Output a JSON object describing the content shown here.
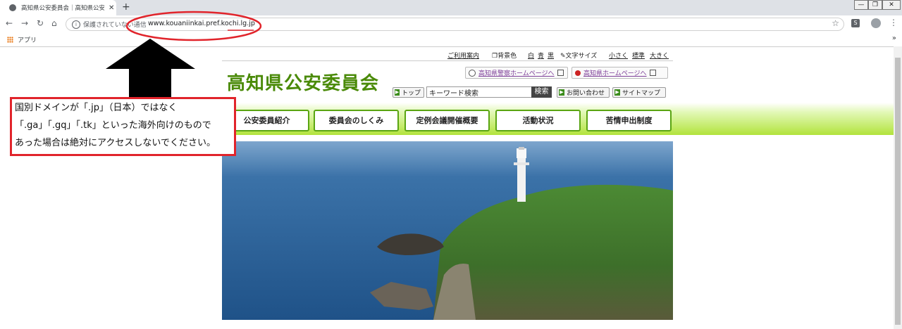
{
  "browser": {
    "tab_title": "高知県公安委員会｜高知県公安委",
    "tab_close": "✕",
    "new_tab": "+",
    "security_label": "保護されていない通信",
    "url": "www.kouaniinkai.pref.kochi.lg.jp",
    "bookmark_apps": "アプリ",
    "bookmark_more": "»",
    "profile_initial": "S"
  },
  "utility": {
    "guide": "ご利用案内",
    "bgcolor_label": "背景色",
    "bg_white": "白",
    "bg_blue": "青",
    "bg_black": "黒",
    "fontsize_label": "文字サイズ",
    "size_small": "小さく",
    "size_std": "標準",
    "size_large": "大きく"
  },
  "header": {
    "site_title": "高知県公安委員会",
    "police_link": "高知県警察ホームページへ",
    "pref_link": "高知県ホームページへ",
    "top_button": "トップ",
    "search_placeholder": "キーワード検索",
    "search_button": "検索",
    "contact_button": "お問い合わせ",
    "sitemap_button": "サイトマップ"
  },
  "nav": [
    {
      "label": "公安委員紹介"
    },
    {
      "label": "委員会のしくみ"
    },
    {
      "label": "定例会議開催概要"
    },
    {
      "label": "活動状況"
    },
    {
      "label": "苦情申出制度"
    }
  ],
  "annotation": {
    "line1": "国別ドメインが「.jp」（日本）ではなく",
    "line2": "「.ga」「.gq」「.tk」といった海外向けのもので",
    "line3": "あった場合は絶対にアクセスしないでください。"
  },
  "colors": {
    "annotation_red": "#e1242b",
    "brand_green": "#4a8a08",
    "nav_border": "#5aa512"
  }
}
